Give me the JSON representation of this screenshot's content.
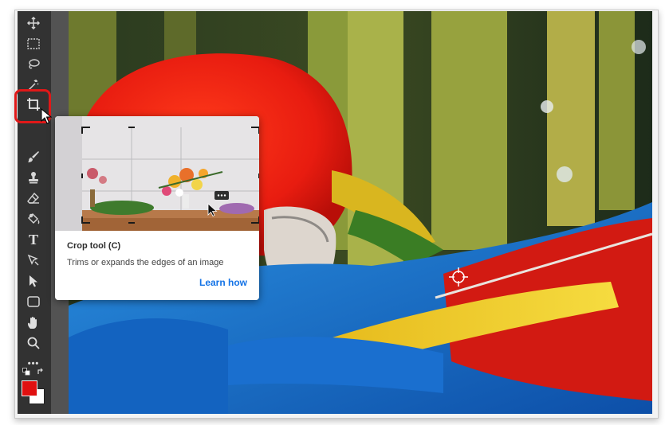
{
  "app": {
    "accent": "#e01818",
    "link_color": "#1473e6"
  },
  "toolbar": {
    "tools": [
      {
        "name": "move-tool",
        "icon": "move-icon"
      },
      {
        "name": "marquee-tool",
        "icon": "marquee-icon"
      },
      {
        "name": "lasso-tool",
        "icon": "lasso-icon"
      },
      {
        "name": "magic-wand-tool",
        "icon": "magic-wand-icon"
      },
      {
        "name": "crop-tool",
        "icon": "crop-icon",
        "active": true
      },
      {
        "name": "brush-tool",
        "icon": "brush-icon"
      },
      {
        "name": "stamp-tool",
        "icon": "stamp-icon"
      },
      {
        "name": "eraser-tool",
        "icon": "eraser-icon"
      },
      {
        "name": "paint-bucket-tool",
        "icon": "paint-bucket-icon"
      },
      {
        "name": "type-tool",
        "icon": "type-icon",
        "glyph": "T"
      },
      {
        "name": "path-selection-tool",
        "icon": "path-selection-icon"
      },
      {
        "name": "direct-selection-tool",
        "icon": "arrow-icon"
      },
      {
        "name": "shape-tool",
        "icon": "rectangle-icon"
      },
      {
        "name": "hand-tool",
        "icon": "hand-icon"
      },
      {
        "name": "zoom-tool",
        "icon": "zoom-icon"
      },
      {
        "name": "more-tools",
        "icon": "more-icon",
        "glyph": "•••"
      }
    ],
    "foreground_color": "#e01010",
    "background_color": "#ffffff"
  },
  "tooltip": {
    "title": "Crop tool (C)",
    "description": "Trims or expands the edges of an image",
    "link": "Learn how"
  }
}
